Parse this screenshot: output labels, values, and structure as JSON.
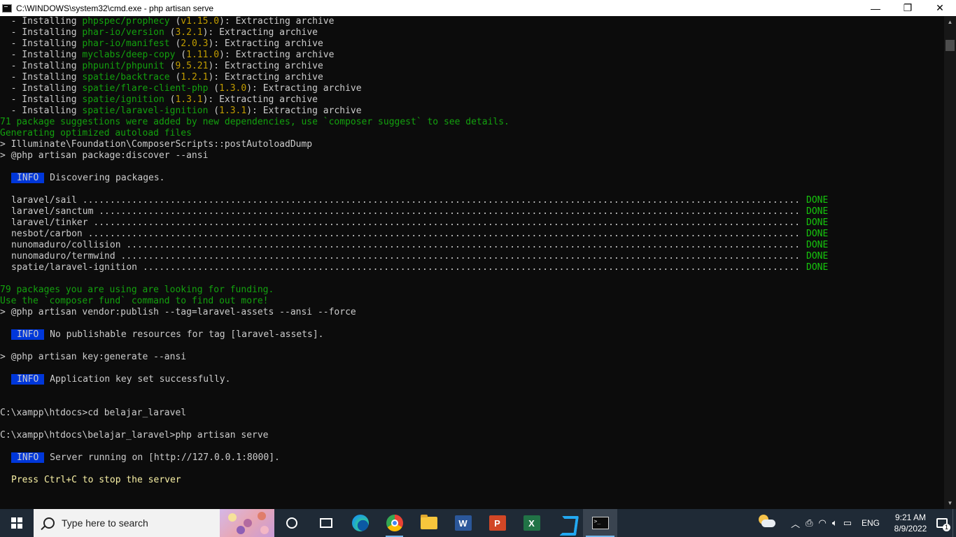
{
  "window": {
    "title": "C:\\WINDOWS\\system32\\cmd.exe - php  artisan serve",
    "minimize": "—",
    "maximize": "❐",
    "close": "✕"
  },
  "console": {
    "install_lines": [
      {
        "prefix": "  - Installing ",
        "pkg": "phpspec/prophecy",
        "open": " (",
        "ver": "v1.15.0",
        "close": "): Extracting archive"
      },
      {
        "prefix": "  - Installing ",
        "pkg": "phar-io/version",
        "open": " (",
        "ver": "3.2.1",
        "close": "): Extracting archive"
      },
      {
        "prefix": "  - Installing ",
        "pkg": "phar-io/manifest",
        "open": " (",
        "ver": "2.0.3",
        "close": "): Extracting archive"
      },
      {
        "prefix": "  - Installing ",
        "pkg": "myclabs/deep-copy",
        "open": " (",
        "ver": "1.11.0",
        "close": "): Extracting archive"
      },
      {
        "prefix": "  - Installing ",
        "pkg": "phpunit/phpunit",
        "open": " (",
        "ver": "9.5.21",
        "close": "): Extracting archive"
      },
      {
        "prefix": "  - Installing ",
        "pkg": "spatie/backtrace",
        "open": " (",
        "ver": "1.2.1",
        "close": "): Extracting archive"
      },
      {
        "prefix": "  - Installing ",
        "pkg": "spatie/flare-client-php",
        "open": " (",
        "ver": "1.3.0",
        "close": "): Extracting archive"
      },
      {
        "prefix": "  - Installing ",
        "pkg": "spatie/ignition",
        "open": " (",
        "ver": "1.3.1",
        "close": "): Extracting archive"
      },
      {
        "prefix": "  - Installing ",
        "pkg": "spatie/laravel-ignition",
        "open": " (",
        "ver": "1.3.1",
        "close": "): Extracting archive"
      }
    ],
    "suggestions": "71 package suggestions were added by new dependencies, use `composer suggest` to see details.",
    "autoload": "Generating optimized autoload files",
    "postautoload": "> Illuminate\\Foundation\\ComposerScripts::postAutoloadDump",
    "package_discover": "> @php artisan package:discover --ansi",
    "info_label": "INFO",
    "discovering": "Discovering packages.",
    "discovered": [
      {
        "name": "laravel/sail",
        "status": "DONE"
      },
      {
        "name": "laravel/sanctum",
        "status": "DONE"
      },
      {
        "name": "laravel/tinker",
        "status": "DONE"
      },
      {
        "name": "nesbot/carbon",
        "status": "DONE"
      },
      {
        "name": "nunomaduro/collision",
        "status": "DONE"
      },
      {
        "name": "nunomaduro/termwind",
        "status": "DONE"
      },
      {
        "name": "spatie/laravel-ignition",
        "status": "DONE"
      }
    ],
    "funding1": "79 packages you are using are looking for funding.",
    "funding2": "Use the `composer fund` command to find out more!",
    "vendor_publish": "> @php artisan vendor:publish --tag=laravel-assets --ansi --force",
    "no_publishable": "No publishable resources for tag [laravel-assets].",
    "key_generate": "> @php artisan key:generate --ansi",
    "key_set": "Application key set successfully.",
    "cd_cmd": "C:\\xampp\\htdocs>cd belajar_laravel",
    "serve_cmd": "C:\\xampp\\htdocs\\belajar_laravel>php artisan serve",
    "server_running": "Server running on [http://127.0.0.1:8000].",
    "press_ctrl": "Press Ctrl+C to stop the server"
  },
  "taskbar": {
    "search_placeholder": "Type here to search",
    "lang": "ENG",
    "time": "9:21 AM",
    "date": "8/9/2022",
    "notification_count": "1",
    "word_letter": "W",
    "ppt_letter": "P",
    "excel_letter": "X",
    "icons": [
      "windows-icon",
      "search-icon",
      "cortana-icon",
      "task-view-icon",
      "edge-icon",
      "chrome-icon",
      "file-explorer-icon",
      "word-icon",
      "powerpoint-icon",
      "excel-icon",
      "vscode-icon",
      "cmd-icon"
    ]
  },
  "colors": {
    "console_bg": "#0c0c0c",
    "package_green": "#13a10e",
    "version_yellow": "#c19c00",
    "done_green": "#16c60c",
    "info_bg": "#0037da",
    "press_yellow": "#f9f1a5",
    "taskbar_bg": "#1f2a36"
  }
}
